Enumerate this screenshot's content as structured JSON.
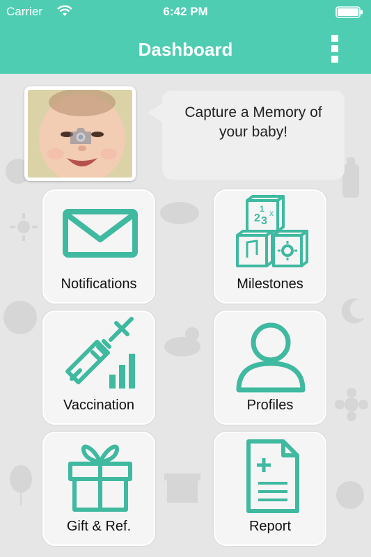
{
  "status_bar": {
    "carrier": "Carrier",
    "time": "6:42 PM"
  },
  "nav": {
    "title": "Dashboard"
  },
  "capture": {
    "message": "Capture a Memory of your baby!"
  },
  "tiles": [
    {
      "label": "Notifications",
      "icon": "envelope-icon"
    },
    {
      "label": "Milestones",
      "icon": "blocks-icon"
    },
    {
      "label": "Vaccination",
      "icon": "syringe-icon"
    },
    {
      "label": "Profiles",
      "icon": "person-icon"
    },
    {
      "label": "Gift & Ref.",
      "icon": "gift-icon"
    },
    {
      "label": "Report",
      "icon": "document-plus-icon"
    }
  ],
  "colors": {
    "brand": "#4ecdb3",
    "icon": "#3fb9a0",
    "background": "#e6e6e6"
  }
}
